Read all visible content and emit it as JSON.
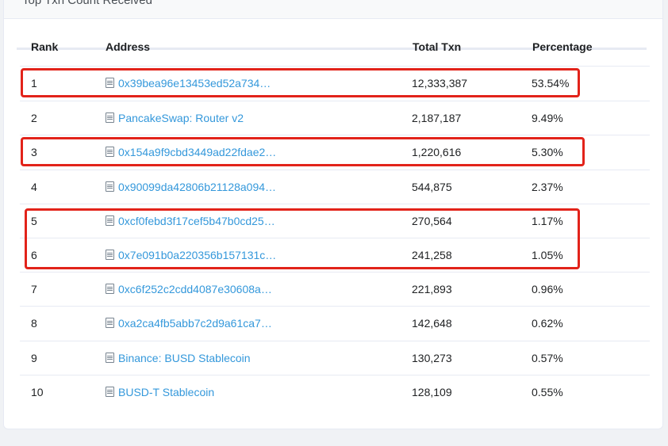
{
  "card": {
    "title": "Top Txn Count Received"
  },
  "table": {
    "headers": {
      "rank": "Rank",
      "address": "Address",
      "total_txn": "Total Txn",
      "percentage": "Percentage"
    },
    "rows": [
      {
        "rank": "1",
        "address": "0x39bea96e13453ed52a734…",
        "total_txn": "12,333,387",
        "percentage": "53.54%"
      },
      {
        "rank": "2",
        "address": "PancakeSwap: Router v2",
        "total_txn": "2,187,187",
        "percentage": "9.49%"
      },
      {
        "rank": "3",
        "address": "0x154a9f9cbd3449ad22fdae2…",
        "total_txn": "1,220,616",
        "percentage": "5.30%"
      },
      {
        "rank": "4",
        "address": "0x90099da42806b21128a094…",
        "total_txn": "544,875",
        "percentage": "2.37%"
      },
      {
        "rank": "5",
        "address": "0xcf0febd3f17cef5b47b0cd25…",
        "total_txn": "270,564",
        "percentage": "1.17%"
      },
      {
        "rank": "6",
        "address": "0x7e091b0a220356b157131c…",
        "total_txn": "241,258",
        "percentage": "1.05%"
      },
      {
        "rank": "7",
        "address": "0xc6f252c2cdd4087e30608a…",
        "total_txn": "221,893",
        "percentage": "0.96%"
      },
      {
        "rank": "8",
        "address": "0xa2ca4fb5abb7c2d9a61ca7…",
        "total_txn": "142,648",
        "percentage": "0.62%"
      },
      {
        "rank": "9",
        "address": "Binance: BUSD Stablecoin",
        "total_txn": "130,273",
        "percentage": "0.57%"
      },
      {
        "rank": "10",
        "address": "BUSD-T Stablecoin",
        "total_txn": "128,109",
        "percentage": "0.55%"
      }
    ]
  },
  "colors": {
    "link": "#3498db",
    "highlight": "#e2231a"
  },
  "icons": {
    "address_icon": "contract-document-icon"
  }
}
